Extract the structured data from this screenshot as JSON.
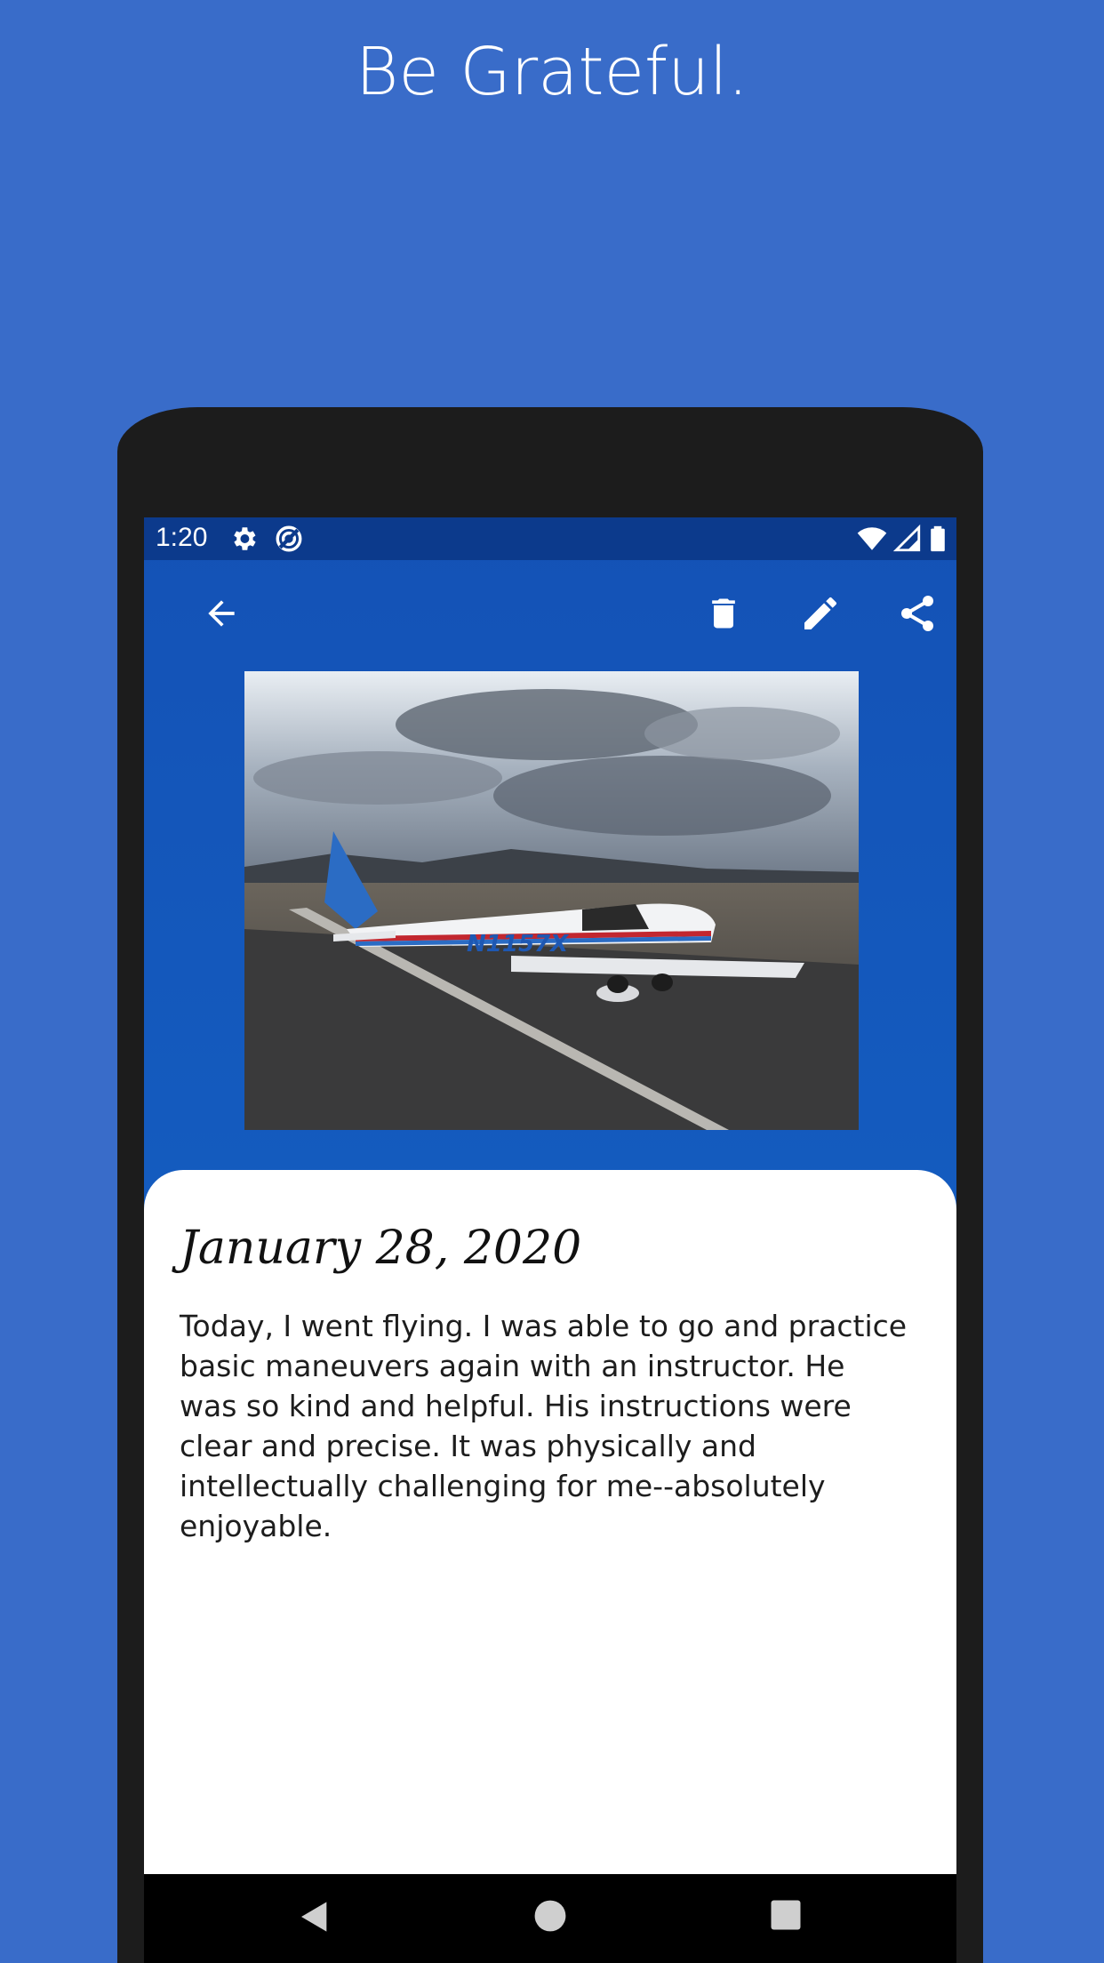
{
  "headline": "Be Grateful.",
  "status_bar": {
    "time": "1:20",
    "left_icons": [
      "settings-icon",
      "sync-icon"
    ],
    "right_icons": [
      "wifi-icon",
      "signal-icon",
      "battery-icon"
    ]
  },
  "toolbar": {
    "back": "back-arrow-icon",
    "actions": [
      "delete-icon",
      "edit-icon",
      "share-icon"
    ]
  },
  "photo": {
    "subject": "airplane-photo",
    "tail_number": "N1157X"
  },
  "entry": {
    "date": "January 28, 2020",
    "text": "Today, I went flying. I was able to go and practice basic maneuvers again with an instructor. He was so kind and helpful. His instructions were clear and precise. It was physically and intellectually challenging for me--absolutely enjoyable."
  },
  "nav_bar": [
    "back-triangle-icon",
    "home-circle-icon",
    "recents-square-icon"
  ],
  "colors": {
    "background": "#396cc9",
    "status_bar": "#0c3a8c",
    "app_bar": "#1452b6",
    "card": "#ffffff"
  }
}
